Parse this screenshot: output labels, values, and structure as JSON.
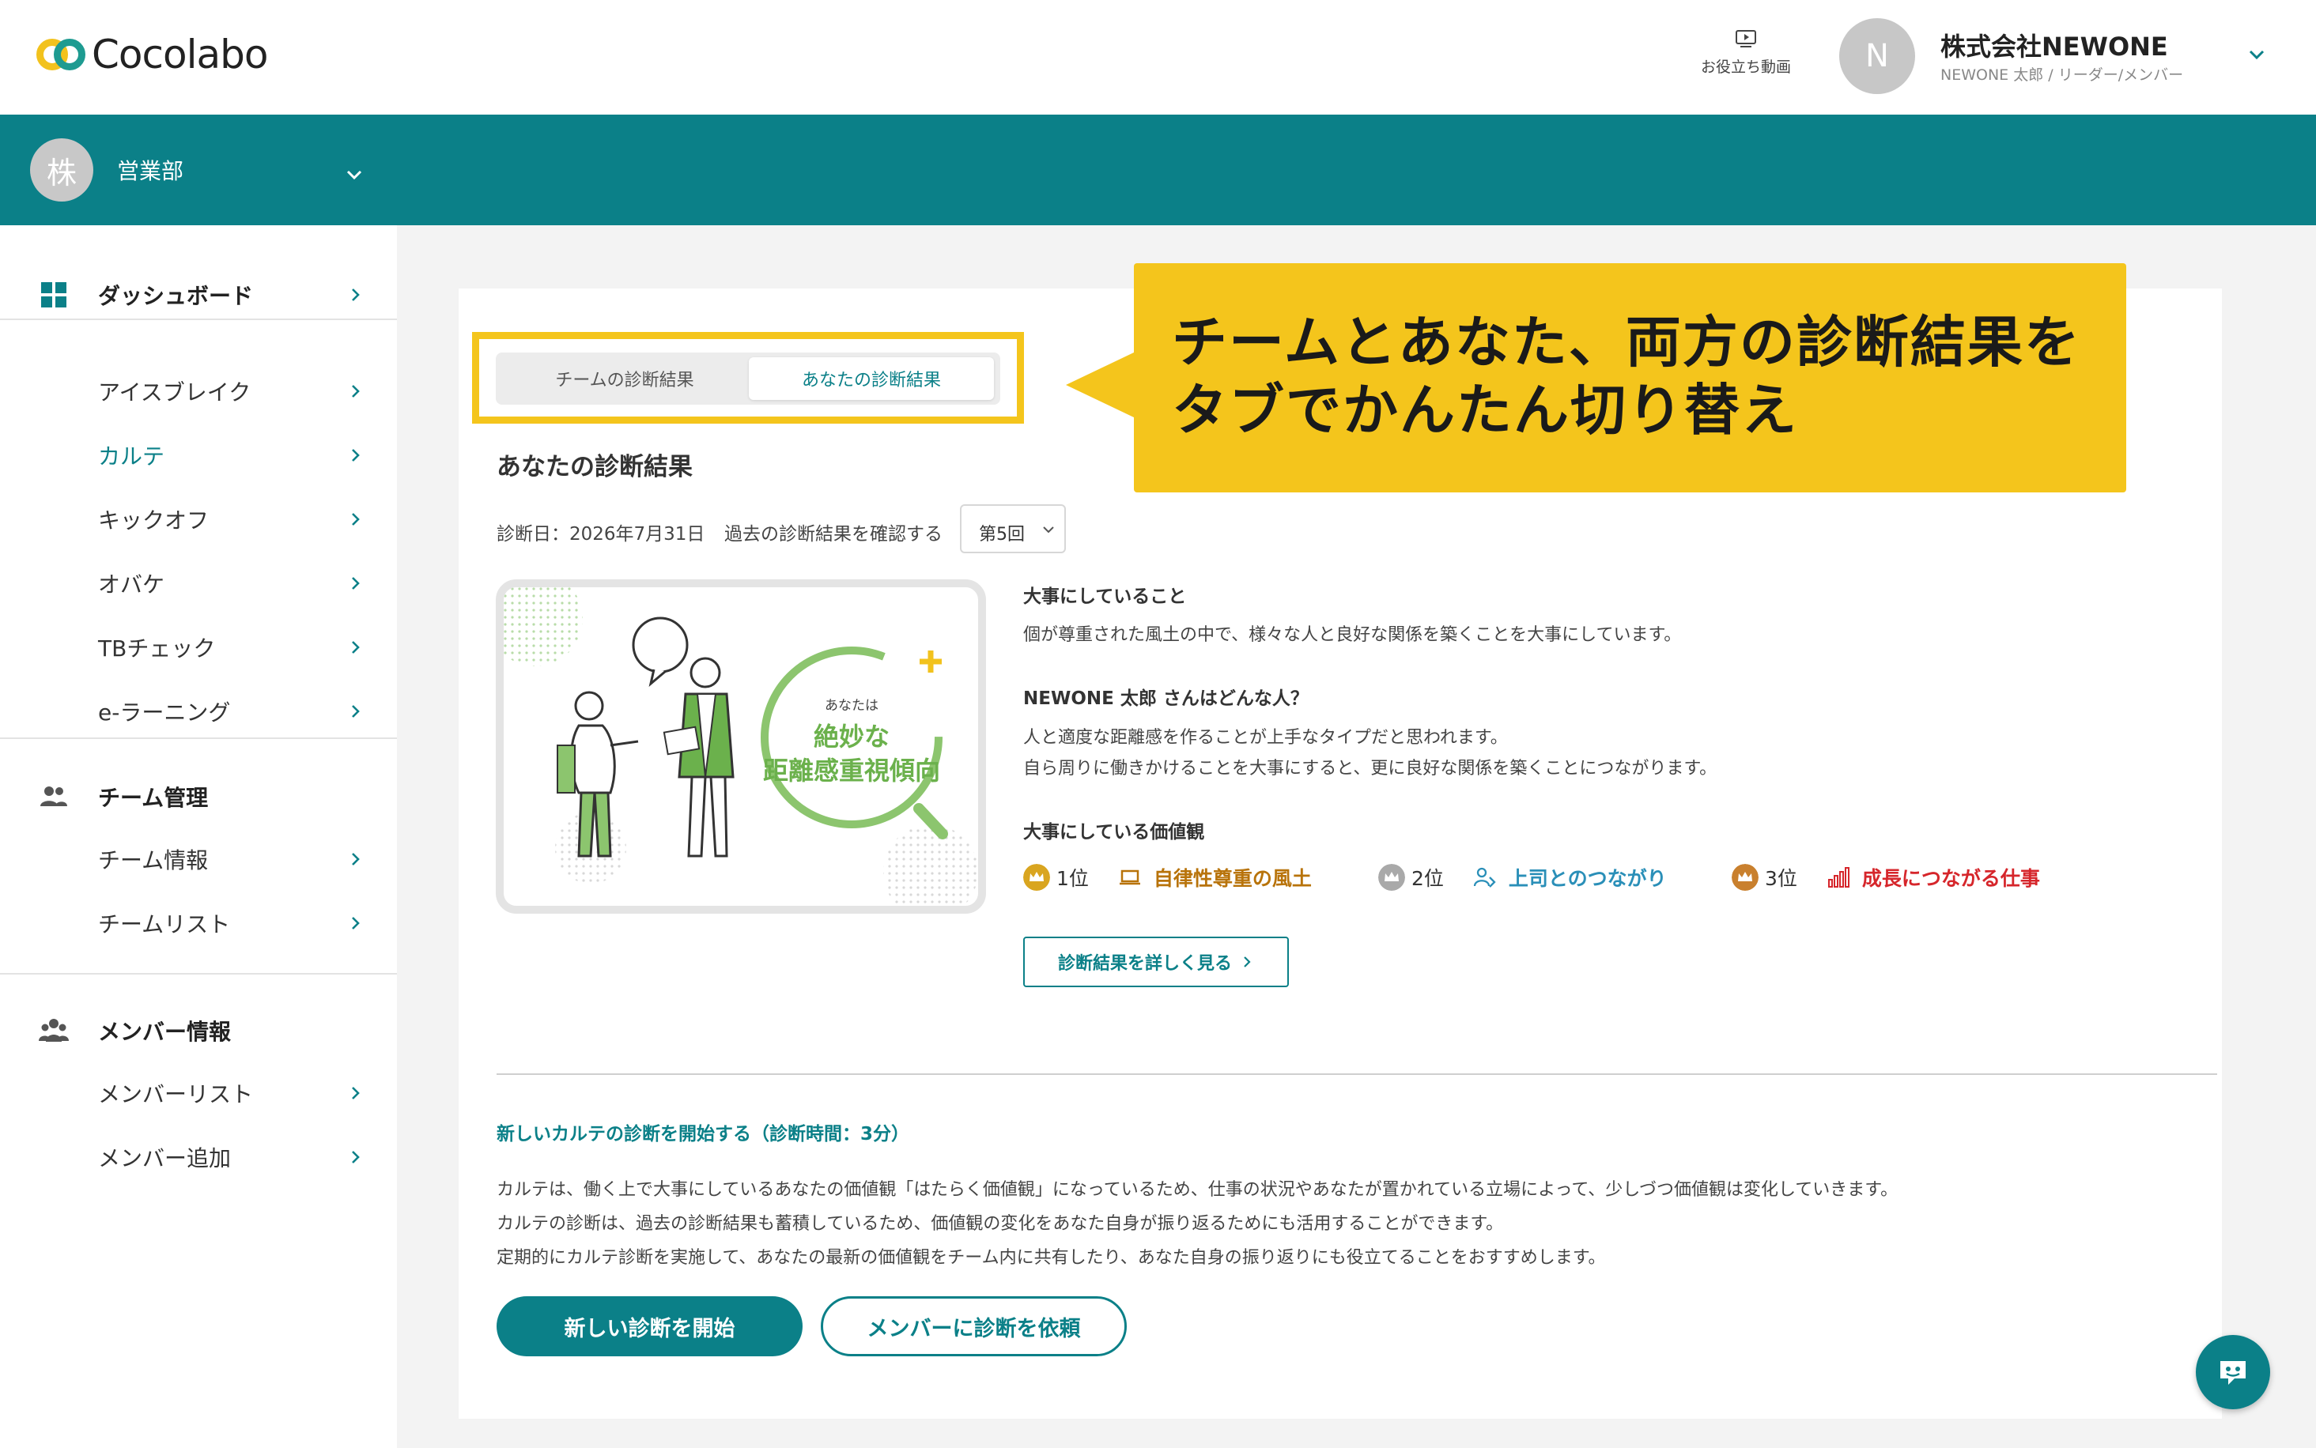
{
  "header": {
    "logo_text": "Cocolabo",
    "video_label": "お役立ち動画",
    "avatar_letter": "N",
    "company_name": "株式会社NEWONE",
    "company_role": "NEWONE 太郎 / リーダー/メンバー"
  },
  "team": {
    "avatar_letter": "株",
    "name": "営業部"
  },
  "sidebar": {
    "dashboard": "ダッシュボード",
    "items": [
      {
        "label": "アイスブレイク"
      },
      {
        "label": "カルテ"
      },
      {
        "label": "キックオフ"
      },
      {
        "label": "オバケ"
      },
      {
        "label": "TBチェック"
      },
      {
        "label": "e-ラーニング"
      }
    ],
    "team_section": "チーム管理",
    "team_items": [
      {
        "label": "チーム情報"
      },
      {
        "label": "チームリスト"
      }
    ],
    "member_section": "メンバー情報",
    "member_items": [
      {
        "label": "メンバーリスト"
      },
      {
        "label": "メンバー追加"
      }
    ],
    "active_item": "カルテ"
  },
  "tabs": [
    {
      "label": "チームの診断結果"
    },
    {
      "label": "あなたの診断結果"
    }
  ],
  "callout": {
    "line1": "チームとあなた、両方の診断結果を",
    "line2": "タブでかんたん切り替え"
  },
  "result": {
    "title": "あなたの診断結果",
    "date": "診断日：2026年7月31日",
    "past_label": "過去の診断結果を確認する",
    "round": "第5回",
    "illustration": {
      "small": "あなたは",
      "line1": "絶妙な",
      "line2": "距離感重視傾向"
    },
    "important_heading": "大事にしていること",
    "important_text": "個が尊重された風土の中で、様々な人と良好な関係を築くことを大事にしています。",
    "person_heading": "NEWONE 太郎 さんはどんな人？",
    "person_text_1": "人と適度な距離感を作ることが上手なタイプだと思われます。",
    "person_text_2": "自ら周りに働きかけることを大事にすると、更に良好な関係を築くことにつながります。",
    "values_heading": "大事にしている価値観",
    "values": [
      {
        "place": "1位",
        "name": "自律性尊重の風土",
        "color": "#b8730a"
      },
      {
        "place": "2位",
        "name": "上司とのつながり",
        "color": "#2a8fb8"
      },
      {
        "place": "3位",
        "name": "成長につながる仕事",
        "color": "#d6262b"
      }
    ],
    "detail_button": "診断結果を詳しく見る"
  },
  "new_diagnosis": {
    "title": "新しいカルテの診断を開始する（診断時間：3分）",
    "desc_1": "カルテは、働く上で大事にしているあなたの価値観「はたらく価値観」になっているため、仕事の状況やあなたが置かれている立場によって、少しづつ価値観は変化していきます。",
    "desc_2": "カルテの診断は、過去の診断結果も蓄積しているため、価値観の変化をあなた自身が振り返るためにも活用することができます。",
    "desc_3": "定期的にカルテ診断を実施して、あなたの最新の価値観をチーム内に共有したり、あなた自身の振り返りにも役立てることをおすすめします。",
    "start_button": "新しい診断を開始",
    "request_button": "メンバーに診断を依頼"
  },
  "colors": {
    "brand": "#0b8088",
    "accent_yellow": "#f4c51c"
  }
}
